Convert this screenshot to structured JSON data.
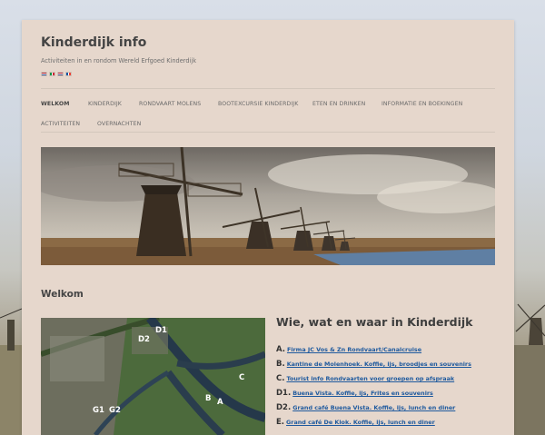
{
  "site": {
    "title": "Kinderdijk info",
    "description": "Activiteiten in en rondom Wereld Erfgoed Kinderdijk"
  },
  "language_flags": [
    {
      "icon": "flag-nl-icon",
      "colors": [
        "#ae1c28",
        "#ffffff",
        "#21468b"
      ],
      "orientation": "horizontal"
    },
    {
      "icon": "flag-it-icon",
      "colors": [
        "#009246",
        "#ffffff",
        "#ce2b37"
      ],
      "orientation": "vertical"
    },
    {
      "icon": "flag-us-icon",
      "colors": [
        "#b22234",
        "#ffffff",
        "#3c3b6e"
      ],
      "orientation": "horizontal"
    },
    {
      "icon": "flag-fr-icon",
      "colors": [
        "#0055a4",
        "#ffffff",
        "#ef4135"
      ],
      "orientation": "vertical"
    }
  ],
  "nav": {
    "items": [
      {
        "label": "WELKOM",
        "active": true
      },
      {
        "label": "KINDERDIJK",
        "active": false
      },
      {
        "label": "RONDVAART MOLENS",
        "active": false
      },
      {
        "label": "BOOTEXCURSIE KINDERDIJK",
        "active": false
      },
      {
        "label": "ETEN EN DRINKEN",
        "active": false
      },
      {
        "label": "INFORMATIE EN BOEKINGEN",
        "active": false
      },
      {
        "label": "ACTIVITEITEN",
        "active": false
      },
      {
        "label": "OVERNACHTEN",
        "active": false
      }
    ]
  },
  "main": {
    "heading": "Welkom",
    "info_title": "Wie, wat en waar in Kinderdijk",
    "map_labels": [
      "D1",
      "D2",
      "C",
      "B",
      "A",
      "G1",
      "G2"
    ],
    "locations": [
      {
        "letter": "A.",
        "text": "Firma JC Vos & Zn Rondvaart/Canalcruise"
      },
      {
        "letter": "B.",
        "text": "Kantine de Molenhoek. Koffie, ijs, broodjes en souvenirs"
      },
      {
        "letter": "C.",
        "text": "Tourist info Rondvaarten voor groepen op afspraak"
      },
      {
        "letter": "D1.",
        "text": " Buena Vista. Koffie, ijs, Frites en souvenirs"
      },
      {
        "letter": "D2.",
        "text": " Grand café Buena Vista. Koffie, ijs, lunch en diner"
      },
      {
        "letter": "E.",
        "text": " Grand café De Klok. Koffie, ijs, lunch en diner"
      }
    ]
  },
  "colors": {
    "page_bg": "#e6d7cc",
    "link": "#1f5a9e",
    "text": "#454545"
  }
}
